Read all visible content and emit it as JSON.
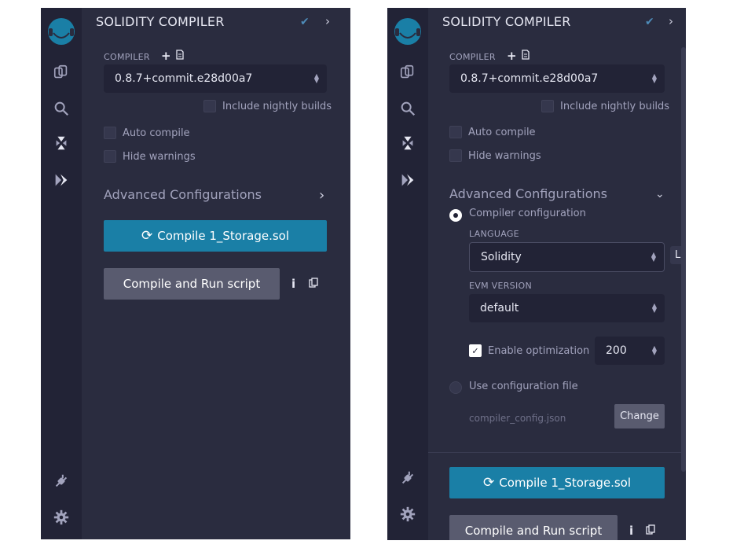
{
  "left": {
    "title": "SOLIDITY COMPILER",
    "compiler_label": "COMPILER",
    "compiler_version": "0.8.7+commit.e28d00a7",
    "nightly": "Include nightly builds",
    "auto_compile": "Auto compile",
    "hide_warnings": "Hide warnings",
    "advanced": "Advanced Configurations",
    "compile_button": "Compile 1_Storage.sol",
    "run_button": "Compile and Run script"
  },
  "right": {
    "title": "SOLIDITY COMPILER",
    "compiler_label": "COMPILER",
    "compiler_version": "0.8.7+commit.e28d00a7",
    "nightly": "Include nightly builds",
    "auto_compile": "Auto compile",
    "hide_warnings": "Hide warnings",
    "advanced": "Advanced Configurations",
    "compiler_configuration": "Compiler configuration",
    "language_label": "LANGUAGE",
    "language_value": "Solidity",
    "language_tooltip": "La",
    "evm_label": "EVM VERSION",
    "evm_value": "default",
    "enable_optimization": "Enable optimization",
    "runs_value": "200",
    "use_config_file": "Use configuration file",
    "config_file": "compiler_config.json",
    "change_button": "Change",
    "compile_button": "Compile 1_Storage.sol",
    "run_button": "Compile and Run script"
  },
  "icons": {
    "logo": "remix-logo-icon",
    "file_explorer": "files-icon",
    "search": "search-icon",
    "compiler": "solidity-compiler-icon",
    "deploy": "deploy-run-icon",
    "plugin": "plugin-icon",
    "settings": "gear-icon",
    "check": "check-icon",
    "chevron": "chevron-right-icon",
    "chevron_down": "chevron-down-icon",
    "plus": "plus-icon",
    "file": "file-icon",
    "refresh": "refresh-icon",
    "info": "info-icon",
    "copy": "copy-icon"
  },
  "colors": {
    "panel_bg": "#2a2c3f",
    "rail_bg": "#222336",
    "accent": "#1a7fa6",
    "secondary_button": "#595b6f",
    "check_color": "#4e8bb8"
  }
}
